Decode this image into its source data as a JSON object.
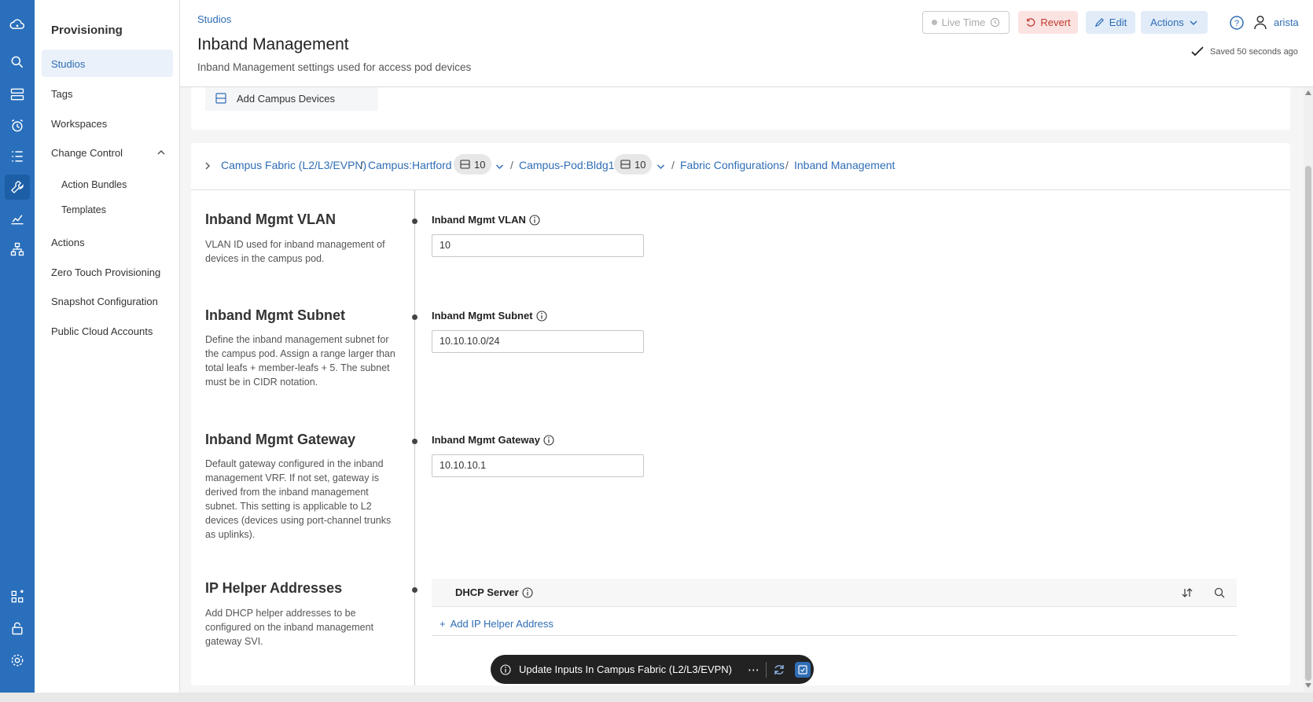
{
  "sidebar": {
    "title": "Provisioning",
    "items": [
      {
        "label": "Studios"
      },
      {
        "label": "Tags"
      },
      {
        "label": "Workspaces"
      },
      {
        "label": "Change Control"
      },
      {
        "label": "Action Bundles"
      },
      {
        "label": "Templates"
      },
      {
        "label": "Actions"
      },
      {
        "label": "Zero Touch Provisioning"
      },
      {
        "label": "Snapshot Configuration"
      },
      {
        "label": "Public Cloud Accounts"
      }
    ]
  },
  "header": {
    "breadcrumb": "Studios",
    "title": "Inband Management",
    "subtitle": "Inband Management settings used for access pod devices",
    "live_time": "Live Time",
    "revert": "Revert",
    "edit": "Edit",
    "actions": "Actions",
    "user": "arista",
    "saved": "Saved 50 seconds ago"
  },
  "top_card": {
    "add_devices": "Add Campus Devices"
  },
  "breadcrumb_path": {
    "items": [
      "Campus Fabric (L2/L3/EVPN)",
      "Campus:Hartford",
      "Campus-Pod:Bldg1",
      "Fabric Configurations",
      "Inband Management"
    ],
    "badge1": "10",
    "badge2": "10",
    "sep": "/"
  },
  "sections": [
    {
      "title": "Inband Mgmt VLAN",
      "desc": "VLAN ID used for inband management of devices in the campus pod.",
      "field_label": "Inband Mgmt VLAN",
      "value": "10"
    },
    {
      "title": "Inband Mgmt Subnet",
      "desc": "Define the inband management subnet for the campus pod. Assign a range larger than total leafs + member-leafs + 5. The subnet must be in CIDR notation.",
      "field_label": "Inband Mgmt Subnet",
      "value": "10.10.10.0/24"
    },
    {
      "title": "Inband Mgmt Gateway",
      "desc": "Default gateway configured in the inband management VRF. If not set, gateway is derived from the inband management subnet. This setting is applicable to L2 devices (devices using port-channel trunks as uplinks).",
      "field_label": "Inband Mgmt Gateway",
      "value": "10.10.10.1"
    },
    {
      "title": "IP Helper Addresses",
      "desc": "Add DHCP helper addresses to be configured on the inband management gateway SVI.",
      "column": "DHCP Server",
      "add_label": "Add IP Helper Address"
    }
  ],
  "toast": {
    "text": "Update Inputs In Campus Fabric (L2/L3/EVPN)"
  }
}
